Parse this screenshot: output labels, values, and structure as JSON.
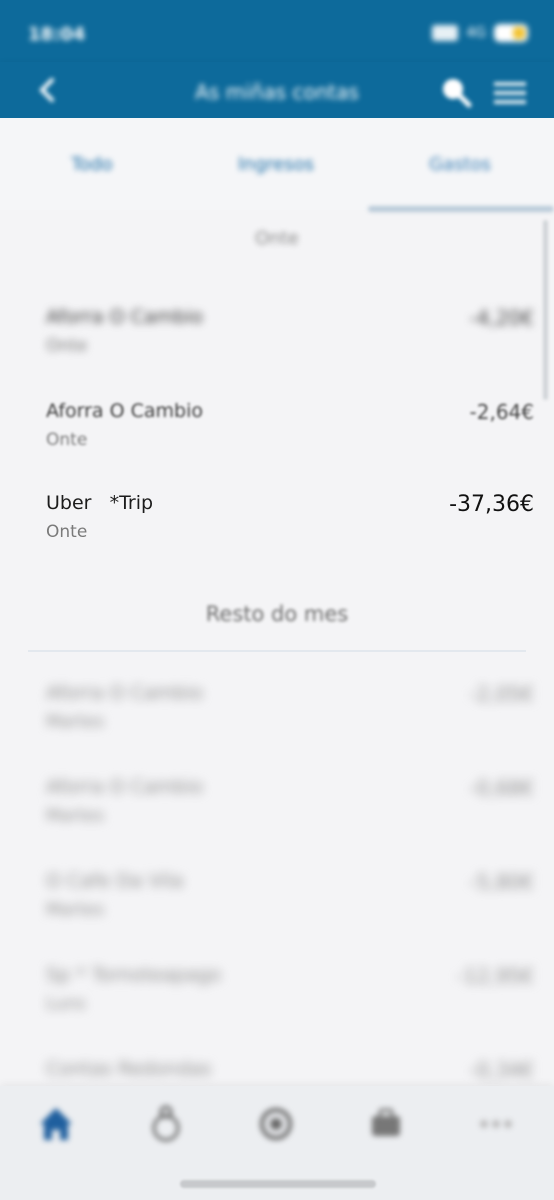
{
  "status_bar": {
    "time": "18:04",
    "network": "4G"
  },
  "header": {
    "title": "As miñas contas"
  },
  "tabs": [
    {
      "label": "Todo"
    },
    {
      "label": "Ingresos"
    },
    {
      "label": "Gastos",
      "selected": true
    }
  ],
  "sections": {
    "yesterday": {
      "title": "Onte"
    },
    "rest_of_month": {
      "title": "Resto do mes"
    }
  },
  "transactions_yesterday": [
    {
      "name": "Aforra O Cambio",
      "date": "Onte",
      "amount": "-4,20€"
    },
    {
      "name": "Aforra O Cambio",
      "date": "Onte",
      "amount": "-2,64€"
    },
    {
      "name": "Uber   *Trip",
      "date": "Onte",
      "amount": "-37,36€"
    }
  ],
  "transactions_rest": [
    {
      "name": "Aforra O Cambio",
      "date": "Martes",
      "amount": "-2,05€"
    },
    {
      "name": "Aforra O Cambio",
      "date": "Martes",
      "amount": "-0,68€"
    },
    {
      "name": "O Cafe Da Vila",
      "date": "Martes",
      "amount": "-5,80€"
    },
    {
      "name": "Sp * Tornoteapago",
      "date": "Luns",
      "amount": "-12,95€"
    },
    {
      "name": "Contas Redondas",
      "date": "",
      "amount": "-0,34€"
    }
  ],
  "bottom_nav": [
    {
      "icon": "home-icon",
      "active": true
    },
    {
      "icon": "piggy-bank-icon"
    },
    {
      "icon": "settings-icon"
    },
    {
      "icon": "briefcase-icon"
    },
    {
      "icon": "more-icon"
    }
  ],
  "colors": {
    "primary": "#0d6a9b",
    "background": "#f4f4f6",
    "active_nav": "#1f5f9e"
  }
}
